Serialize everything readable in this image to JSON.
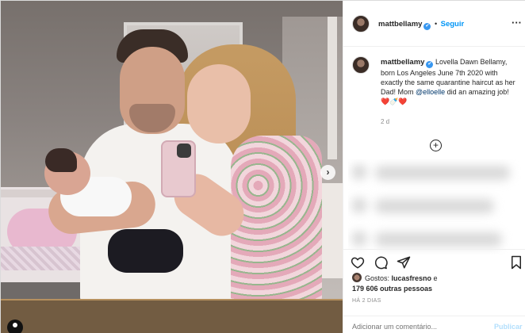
{
  "post": {
    "author": "mattbellamy",
    "follow_label": "Seguir",
    "more_label": "···",
    "separator": "•",
    "verified_icon": "✔"
  },
  "caption": {
    "author": "mattbellamy",
    "text_before_mention": "Lovella Dawn Bellamy, born Los Angeles June 7th 2020 with exactly the same quarantine haircut as her Dad! Mom ",
    "mention": "@elloelle",
    "text_after_mention": " did an amazing job! ❤️🍼❤️",
    "time": "2 d"
  },
  "load_more_label": "+",
  "carousel_next_label": "›",
  "likes": {
    "prefix": "Gostos: ",
    "user": "lucasfresno",
    "connector": " e",
    "count": "179 606 outras pessoas"
  },
  "posted_ago": "HÁ 2 DIAS",
  "comment": {
    "placeholder": "Adicionar um comentário...",
    "publish_label": "Publicar"
  },
  "icons": [
    "heart-icon",
    "comment-icon",
    "share-icon",
    "bookmark-icon",
    "more-icon",
    "verified-icon",
    "add-circle-icon",
    "carousel-next-icon"
  ],
  "colors": {
    "link_blue": "#0095f6",
    "verified_blue": "#3897f0",
    "muted": "#8e8e8e",
    "mention": "#00376b"
  }
}
